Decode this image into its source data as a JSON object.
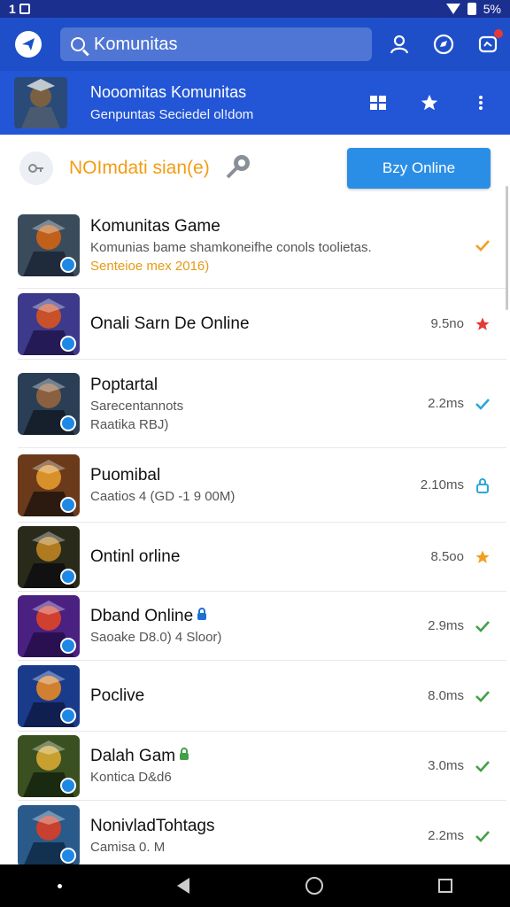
{
  "status_bar": {
    "time": "1",
    "battery": "5%"
  },
  "app_bar": {
    "search_text": "Komunitas"
  },
  "community": {
    "title": "Nooomitas Komunitas",
    "subtitle": "Genpuntas Seciedel ol!dom"
  },
  "status_row": {
    "mode_text": "NOImdati sian(e)",
    "online_button": "Bzy Online"
  },
  "list": [
    {
      "title": "Komunitas Game",
      "sub1": "Komunias bame shamkoneifhe conols toolietas.",
      "sub2": "Senteioe  mex 2016)",
      "sub2_accent": true,
      "size": "",
      "status": "check",
      "status_color": "#f0a020",
      "colors": [
        "#3a4b5c",
        "#c0601a",
        "#1f2a3a"
      ]
    },
    {
      "title": "Onali Sarn De Online",
      "sub1": "",
      "sub2": "",
      "size": "9.5no",
      "status": "star",
      "status_color": "#e53935",
      "colors": [
        "#3d3a8c",
        "#c8502a",
        "#241a55"
      ]
    },
    {
      "title": "Poptartal",
      "sub1": "Sarecentannots",
      "sub2": "Raatika RBJ)",
      "size": "2.2ms",
      "status": "check",
      "status_color": "#2aa8d8",
      "colors": [
        "#2a3f55",
        "#8a6040",
        "#15202c"
      ]
    },
    {
      "title": "Puomibal",
      "sub1": "Caatios 4 (GD -1 9 00M)",
      "sub2": "",
      "size": "2.10ms",
      "status": "lock",
      "status_color": "#2aa8d8",
      "colors": [
        "#6b3a1a",
        "#d8902a",
        "#2c1a10"
      ]
    },
    {
      "title": "Ontinl orline",
      "sub1": "",
      "sub2": "",
      "size": "8.5oo",
      "status": "star",
      "status_color": "#f0a020",
      "colors": [
        "#2a2a1a",
        "#b07a20",
        "#111"
      ]
    },
    {
      "title": "Dband Online",
      "sub1": "Saoake D8.0)  4 Sloor)",
      "sub2": "",
      "size": "2.9ms",
      "status": "check",
      "status_color": "#43a047",
      "colors": [
        "#4a2080",
        "#d04030",
        "#2a1050"
      ],
      "lock": true,
      "lock_color": "#1e6fd6"
    },
    {
      "title": "Poclive",
      "sub1": "",
      "sub2": "",
      "size": "8.0ms",
      "status": "check",
      "status_color": "#43a047",
      "colors": [
        "#1a3a8a",
        "#d08030",
        "#0e1f50"
      ]
    },
    {
      "title": "Dalah Gam",
      "sub1": "Kontica D&d6",
      "sub2": "",
      "size": "3.0ms",
      "status": "check",
      "status_color": "#43a047",
      "colors": [
        "#3a5020",
        "#c8a030",
        "#1a2a10"
      ],
      "lock": true,
      "lock_color": "#43a047"
    },
    {
      "title": "NonivladTohtags",
      "sub1": "Camisa 0. M",
      "sub2": "",
      "size": "2.2ms",
      "status": "check",
      "status_color": "#43a047",
      "colors": [
        "#2a5a8a",
        "#c84030",
        "#123050"
      ]
    }
  ]
}
